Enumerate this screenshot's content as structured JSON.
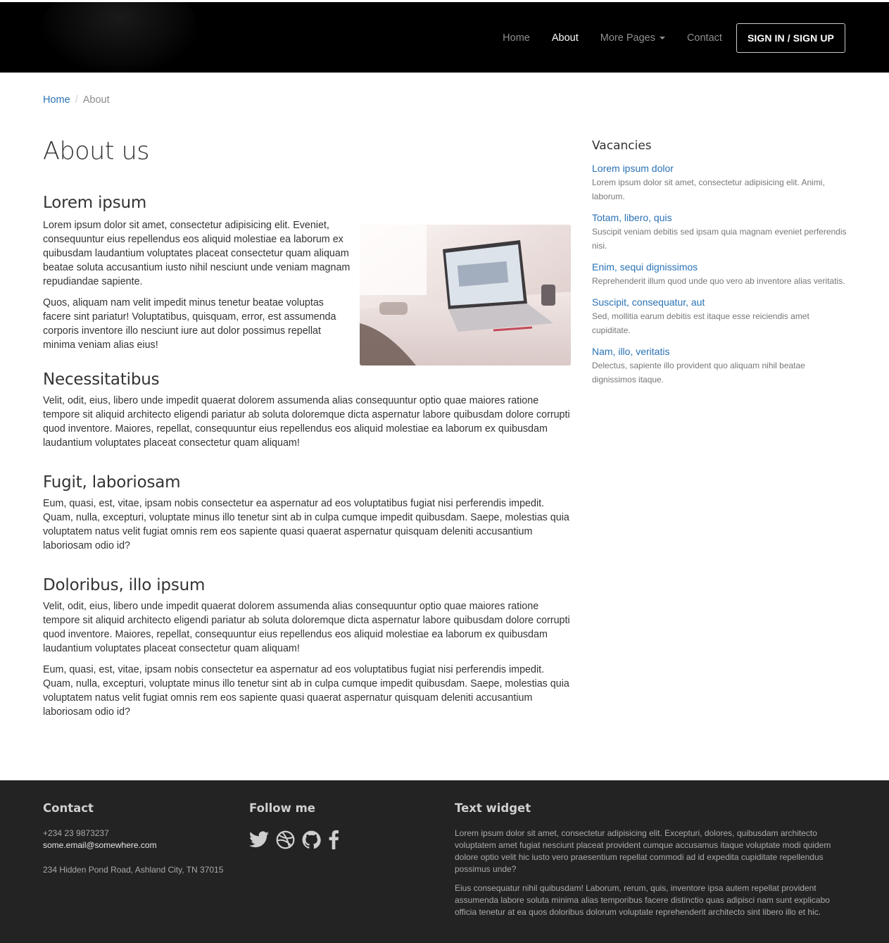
{
  "nav": {
    "items": [
      {
        "label": "Home"
      },
      {
        "label": "About"
      },
      {
        "label": "More Pages"
      },
      {
        "label": "Contact"
      }
    ],
    "signin_label": "SIGN IN / SIGN UP"
  },
  "breadcrumb": {
    "home": "Home",
    "current": "About"
  },
  "main": {
    "title": "About us",
    "sections": [
      {
        "heading": "Lorem ipsum",
        "paragraphs": [
          "Lorem ipsum dolor sit amet, consectetur adipisicing elit. Eveniet, consequuntur eius repellendus eos aliquid molestiae ea laborum ex quibusdam laudantium voluptates placeat consectetur quam aliquam beatae soluta accusantium iusto nihil nesciunt unde veniam magnam repudiandae sapiente.",
          "Quos, aliquam nam velit impedit minus tenetur beatae voluptas facere sint pariatur! Voluptatibus, quisquam, error, est assumenda corporis inventore illo nesciunt iure aut dolor possimus repellat minima veniam alias eius!"
        ]
      },
      {
        "heading": "Necessitatibus",
        "paragraphs": [
          "Velit, odit, eius, libero unde impedit quaerat dolorem assumenda alias consequuntur optio quae maiores ratione tempore sit aliquid architecto eligendi pariatur ab soluta doloremque dicta aspernatur labore quibusdam dolore corrupti quod inventore. Maiores, repellat, consequuntur eius repellendus eos aliquid molestiae ea laborum ex quibusdam laudantium voluptates placeat consectetur quam aliquam!"
        ]
      },
      {
        "heading": "Fugit, laboriosam",
        "paragraphs": [
          "Eum, quasi, est, vitae, ipsam nobis consectetur ea aspernatur ad eos voluptatibus fugiat nisi perferendis impedit. Quam, nulla, excepturi, voluptate minus illo tenetur sint ab in culpa cumque impedit quibusdam. Saepe, molestias quia voluptatem natus velit fugiat omnis rem eos sapiente quasi quaerat aspernatur quisquam deleniti accusantium laboriosam odio id?"
        ]
      },
      {
        "heading": "Doloribus, illo ipsum",
        "paragraphs": [
          "Velit, odit, eius, libero unde impedit quaerat dolorem assumenda alias consequuntur optio quae maiores ratione tempore sit aliquid architecto eligendi pariatur ab soluta doloremque dicta aspernatur labore quibusdam dolore corrupti quod inventore. Maiores, repellat, consequuntur eius repellendus eos aliquid molestiae ea laborum ex quibusdam laudantium voluptates placeat consectetur quam aliquam!",
          "Eum, quasi, est, vitae, ipsam nobis consectetur ea aspernatur ad eos voluptatibus fugiat nisi perferendis impedit. Quam, nulla, excepturi, voluptate minus illo tenetur sint ab in culpa cumque impedit quibusdam. Saepe, molestias quia voluptatem natus velit fugiat omnis rem eos sapiente quasi quaerat aspernatur quisquam deleniti accusantium laboriosam odio id?"
        ]
      }
    ]
  },
  "sidebar": {
    "title": "Vacancies",
    "items": [
      {
        "title": "Lorem ipsum dolor",
        "text": "Lorem ipsum dolor sit amet, consectetur adipisicing elit. Animi, laborum."
      },
      {
        "title": "Totam, libero, quis",
        "text": "Suscipit veniam debitis sed ipsam quia magnam eveniet perferendis nisi."
      },
      {
        "title": "Enim, sequi dignissimos",
        "text": "Reprehenderit illum quod unde quo vero ab inventore alias veritatis."
      },
      {
        "title": "Suscipit, consequatur, aut",
        "text": "Sed, mollitia earum debitis est itaque esse reiciendis amet cupiditate."
      },
      {
        "title": "Nam, illo, veritatis",
        "text": "Delectus, sapiente illo provident quo aliquam nihil beatae dignissimos itaque."
      }
    ]
  },
  "footer": {
    "contact": {
      "title": "Contact",
      "phone": "+234 23 9873237",
      "email": "some.email@somewhere.com",
      "address": "234 Hidden Pond Road, Ashland City, TN 37015"
    },
    "follow": {
      "title": "Follow me",
      "icons": [
        "twitter-icon",
        "dribbble-icon",
        "github-icon",
        "facebook-icon"
      ]
    },
    "text_widget": {
      "title": "Text widget",
      "paragraphs": [
        "Lorem ipsum dolor sit amet, consectetur adipisicing elit. Excepturi, dolores, quibusdam architecto voluptatem amet fugiat nesciunt placeat provident cumque accusamus itaque voluptate modi quidem dolore optio velit hic iusto vero praesentium repellat commodi ad id expedita cupiditate repellendus possimus unde?",
        "Eius consequatur nihil quibusdam! Laborum, rerum, quis, inventore ipsa autem repellat provident assumenda labore soluta minima alias temporibus facere distinctio quas adipisci nam sunt explicabo officia tenetur at ea quos doloribus dolorum voluptate reprehenderit architecto sint libero illo et hic."
      ]
    }
  },
  "colors": {
    "navbar_bg": "#000000",
    "link": "#2a72b5",
    "footer_bg": "#232323"
  }
}
